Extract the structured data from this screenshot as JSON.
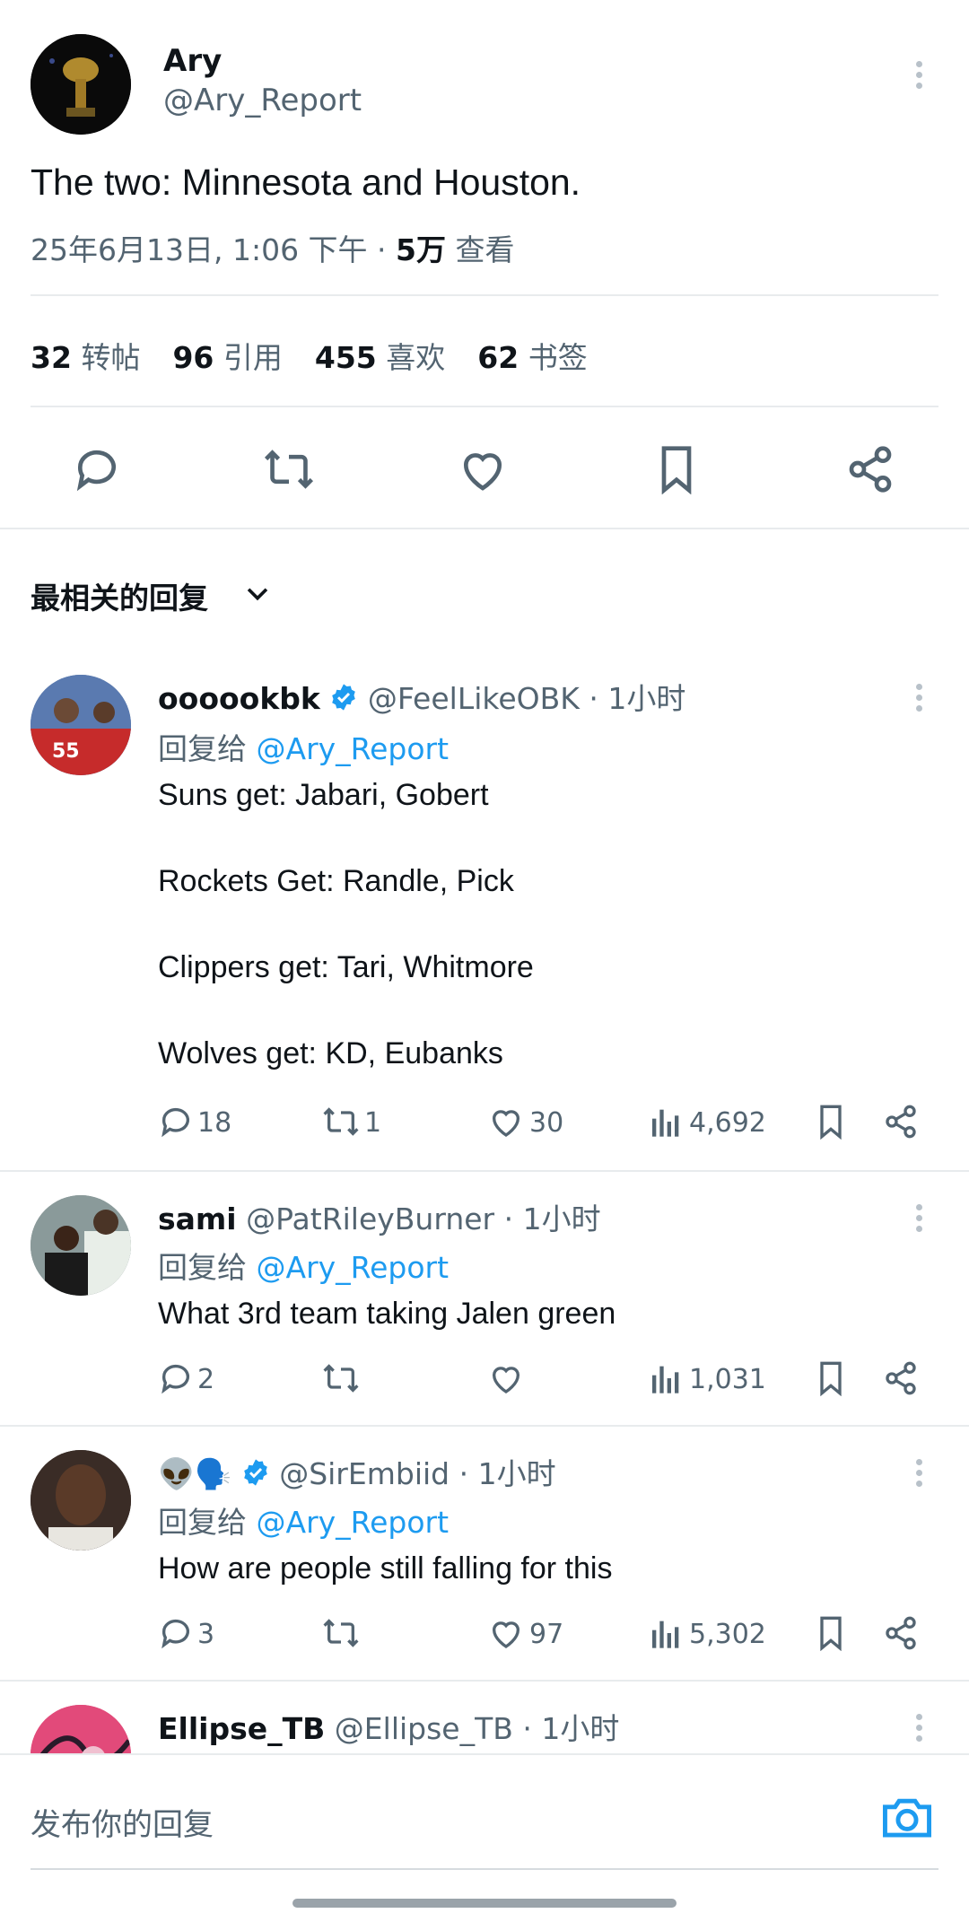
{
  "tweet": {
    "display_name": "Ary",
    "handle": "@Ary_Report",
    "text": "The two: Minnesota and Houston.",
    "timestamp": "25年6月13日, 1:06 下午 · ",
    "views_count": "5万",
    "views_label": " 查看",
    "stats": [
      {
        "count": "32",
        "label": "转帖"
      },
      {
        "count": "96",
        "label": "引用"
      },
      {
        "count": "455",
        "label": "喜欢"
      },
      {
        "count": "62",
        "label": "书签"
      }
    ],
    "action_icons": [
      "reply-icon",
      "retweet-icon",
      "like-icon",
      "bookmark-icon",
      "share-icon"
    ]
  },
  "replies_header": {
    "label": "最相关的回复"
  },
  "replies": [
    {
      "name": "oooookbk",
      "verified": true,
      "handle": "@FeelLikeOBK",
      "time": "· 1小时",
      "replying_prefix": "回复给 ",
      "replying_to": "@Ary_Report",
      "text": "Suns get: Jabari, Gobert\n\nRockets Get: Randle, Pick\n\nClippers get: Tari, Whitmore\n\nWolves get: KD, Eubanks",
      "replies": "18",
      "retweets": "1",
      "likes": "30",
      "views": "4,692"
    },
    {
      "name": "sami",
      "verified": false,
      "handle": "@PatRileyBurner",
      "time": "· 1小时",
      "replying_prefix": "回复给 ",
      "replying_to": "@Ary_Report",
      "text": "What 3rd team taking Jalen green",
      "replies": "2",
      "retweets": "",
      "likes": "",
      "views": "1,031"
    },
    {
      "name": "👽🗣️",
      "verified": true,
      "handle": "@SirEmbiid",
      "time": "· 1小时",
      "replying_prefix": "回复给 ",
      "replying_to": "@Ary_Report",
      "text": "How are people still falling for this",
      "replies": "3",
      "retweets": "",
      "likes": "97",
      "views": "5,302"
    },
    {
      "name": "Ellipse_TB",
      "verified": false,
      "handle": "@Ellipse_TB",
      "time": "· 1小时"
    }
  ],
  "compose": {
    "placeholder": "发布你的回复"
  },
  "colors": {
    "accent": "#1d9bf0",
    "text": "#0f1419",
    "muted": "#536471",
    "divider": "#e8ebed"
  }
}
